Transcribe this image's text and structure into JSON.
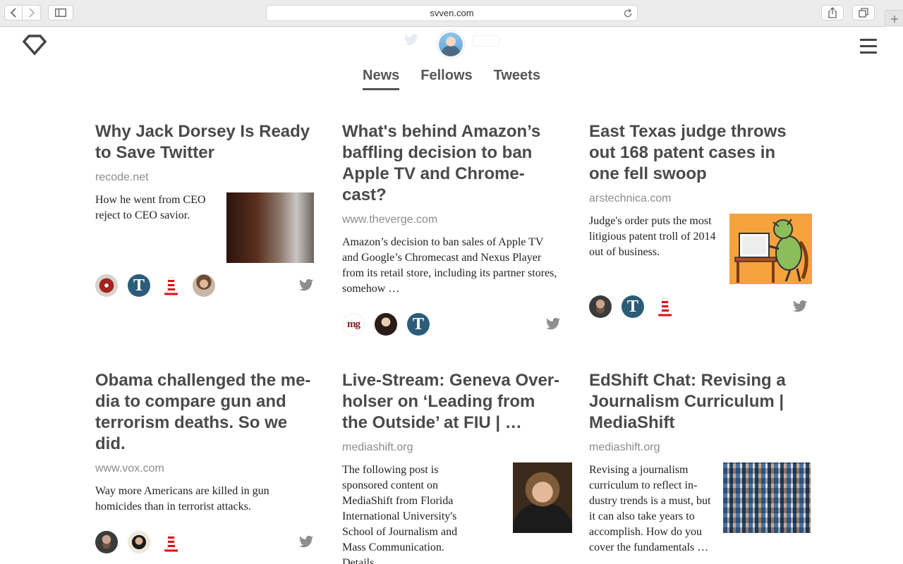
{
  "browser": {
    "url": "svven.com"
  },
  "tabs": [
    {
      "label": "News",
      "active": true
    },
    {
      "label": "Fellows",
      "active": false
    },
    {
      "label": "Tweets",
      "active": false
    }
  ],
  "colors": {
    "text": "#4a4a4a",
    "source": "#8c8c8c",
    "twitter_gray": "#8e8e8e",
    "t_badge": "#2b5d79"
  },
  "cards": [
    {
      "headline": "Why Jack Dorsey Is Ready to Save Twitter",
      "source": "recode.net",
      "summary": "How he went from CEO reject to CEO savior.",
      "avatars": [
        "iron-avatar",
        "t-avatar",
        "hat-avatar",
        "person-avatar"
      ]
    },
    {
      "headline": "What's behind Amazon’s baffling decision to ban Apple TV and Chrome­cast?",
      "source": "www.theverge.com",
      "summary": "Amazon’s decision to ban sales of Apple TV and Google’s Chromecast and Nexus Player from its retail store, including its partner stores, somehow …",
      "avatars": [
        "mg-avatar",
        "bird-avatar",
        "t-avatar"
      ]
    },
    {
      "headline": "East Texas judge throws out 168 patent cases in one fell swoop",
      "source": "arstechnica.com",
      "summary": "Judge's order puts the most litigious patent troll of 2014 out of business.",
      "avatars": [
        "beard-avatar",
        "t-avatar",
        "hat-avatar"
      ]
    },
    {
      "headline": "Obama challenged the me­dia to compare gun and terrorism deaths. So we did.",
      "source": "www.vox.com",
      "summary": "Way more Americans are killed in gun homicides than in terrorist attacks.",
      "avatars": [
        "beard-avatar",
        "hijab-avatar",
        "hat-avatar"
      ]
    },
    {
      "headline": "Live-Stream: Geneva Over­holser on ‘Leading from the Outside’ at FIU | …",
      "source": "mediashift.org",
      "summary": "The following post is sponsored content on MediaShift from Florida International Universi­ty's School of Journalism and Mass Communication. Details …",
      "avatars": []
    },
    {
      "headline": "EdShift Chat: Revising a Journalism Curriculum | MediaShift",
      "source": "mediashift.org",
      "summary": "Revising a journalism curriculum to reflect in­dustry trends is a must, but it can also take years to accomplish. How do you cover the fundamentals …",
      "avatars": []
    }
  ],
  "t_badge_letter": "T",
  "mg_badge_text": "mg"
}
